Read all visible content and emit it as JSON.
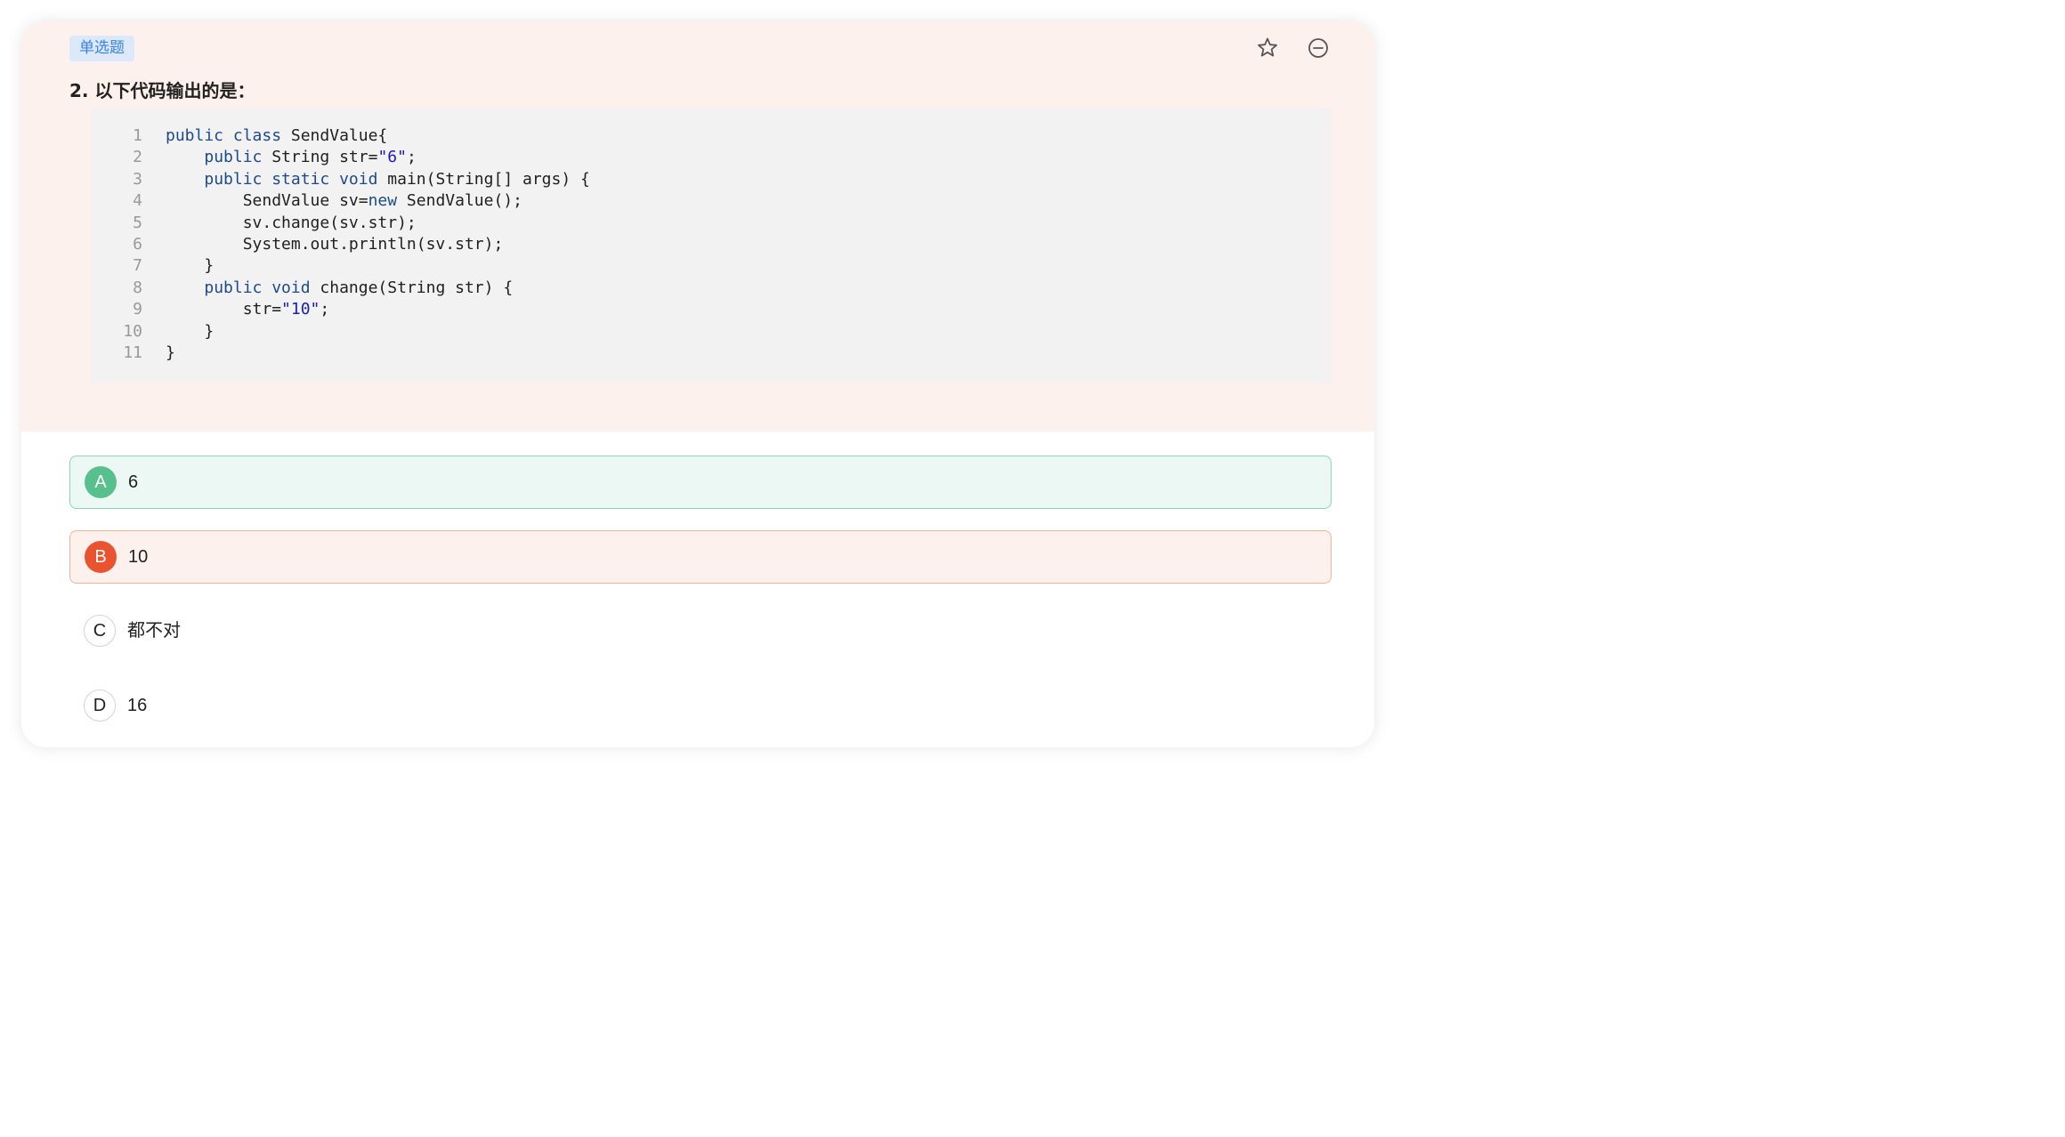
{
  "question": {
    "type_label": "单选题",
    "title": "2. 以下代码输出的是：",
    "code_lines": [
      {
        "num": "1",
        "tokens": [
          {
            "t": "public class",
            "k": "kw"
          },
          {
            "t": " SendValue{",
            "k": ""
          }
        ]
      },
      {
        "num": "2",
        "tokens": [
          {
            "t": "    ",
            "k": ""
          },
          {
            "t": "public",
            "k": "kw"
          },
          {
            "t": " String str=",
            "k": ""
          },
          {
            "t": "\"6\"",
            "k": "str"
          },
          {
            "t": ";",
            "k": ""
          }
        ]
      },
      {
        "num": "3",
        "tokens": [
          {
            "t": "    ",
            "k": ""
          },
          {
            "t": "public static void",
            "k": "kw"
          },
          {
            "t": " main(String[] args) {",
            "k": ""
          }
        ]
      },
      {
        "num": "4",
        "tokens": [
          {
            "t": "        SendValue sv=",
            "k": ""
          },
          {
            "t": "new",
            "k": "kw"
          },
          {
            "t": " SendValue();",
            "k": ""
          }
        ]
      },
      {
        "num": "5",
        "tokens": [
          {
            "t": "        sv.change(sv.str);",
            "k": ""
          }
        ]
      },
      {
        "num": "6",
        "tokens": [
          {
            "t": "        System.out.println(sv.str);",
            "k": ""
          }
        ]
      },
      {
        "num": "7",
        "tokens": [
          {
            "t": "    }",
            "k": ""
          }
        ]
      },
      {
        "num": "8",
        "tokens": [
          {
            "t": "    ",
            "k": ""
          },
          {
            "t": "public void",
            "k": "kw"
          },
          {
            "t": " change(String str) {",
            "k": ""
          }
        ]
      },
      {
        "num": "9",
        "tokens": [
          {
            "t": "        str=",
            "k": ""
          },
          {
            "t": "\"10\"",
            "k": "str"
          },
          {
            "t": ";",
            "k": ""
          }
        ]
      },
      {
        "num": "10",
        "tokens": [
          {
            "t": "    }",
            "k": ""
          }
        ]
      },
      {
        "num": "11",
        "tokens": [
          {
            "t": "}",
            "k": ""
          }
        ]
      }
    ]
  },
  "actions": {
    "favorite_icon": "star-icon",
    "remove_icon": "minus-circle-icon"
  },
  "options": [
    {
      "letter": "A",
      "text": "6",
      "state": "correct"
    },
    {
      "letter": "B",
      "text": "10",
      "state": "wrong"
    },
    {
      "letter": "C",
      "text": "都不对",
      "state": "plain"
    },
    {
      "letter": "D",
      "text": "16",
      "state": "plain"
    }
  ],
  "colors": {
    "question_bg": "#fdf1ed",
    "badge_text": "#3b82e6",
    "badge_bg": "#dbe9fb",
    "correct": "#58c08d",
    "wrong": "#e9532f",
    "keyword": "#1d4a8c",
    "string": "#1a1acc"
  }
}
